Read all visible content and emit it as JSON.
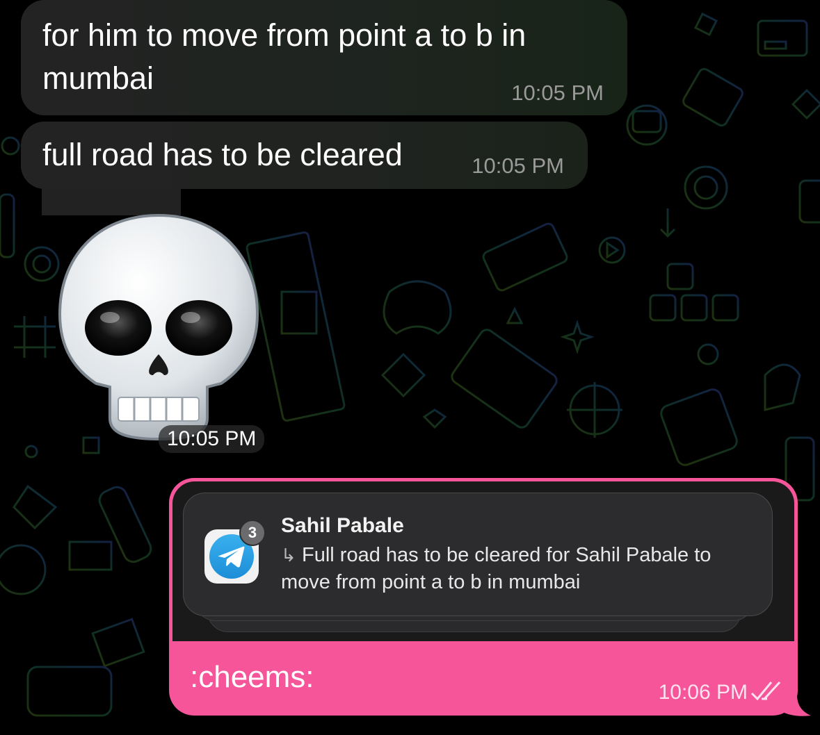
{
  "messages": [
    {
      "text": "for him to move from point a to b in mumbai",
      "time": "10:05 PM"
    },
    {
      "text": "full road has to be cleared",
      "time": "10:05 PM"
    }
  ],
  "sticker": {
    "emoji": "skull",
    "time": "10:05 PM"
  },
  "outgoing": {
    "notification": {
      "badge_count": "3",
      "sender": "Sahil Pabale",
      "body": "Full road has to be cleared for Sahil Pabale to move from point a to b in mumbai",
      "app_icon": "telegram-icon"
    },
    "text": ":cheems:",
    "time": "10:06 PM",
    "status_icon": "double-check-icon"
  },
  "colors": {
    "incoming_bubble": "#1f1f1f",
    "outgoing_bubble": "#f6559a",
    "timestamp_gray": "#9a9a9a"
  }
}
